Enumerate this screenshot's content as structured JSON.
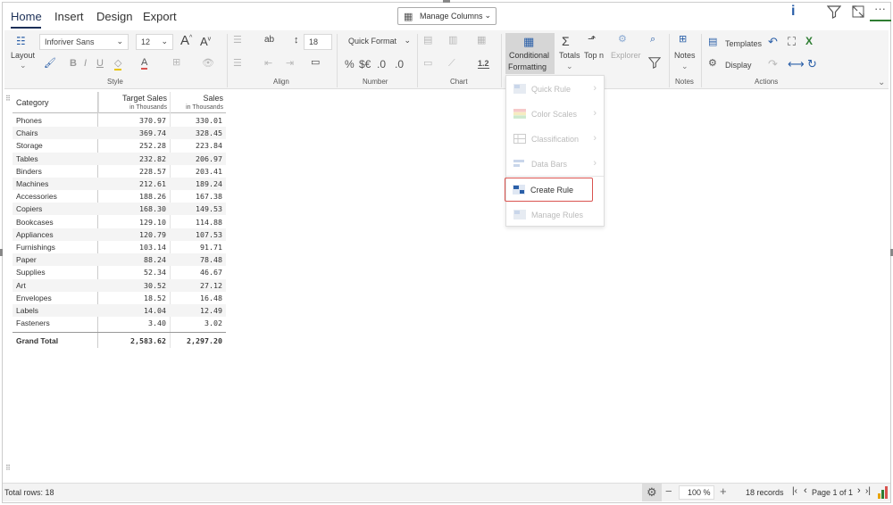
{
  "tabs": [
    "Home",
    "Insert",
    "Design",
    "Export"
  ],
  "manage_columns": "Manage Columns",
  "font_name": "Inforiver Sans",
  "font_size": "12",
  "row_height": "18",
  "number_format": "Quick Format",
  "labels": {
    "layout": "Layout",
    "style": "Style",
    "align": "Align",
    "number": "Number",
    "chart": "Chart",
    "cond1": "Conditional",
    "cond2": "Formatting",
    "totals": "Totals",
    "topn": "Top n",
    "explorer": "Explorer",
    "notes": "Notes",
    "notes_group": "Notes",
    "templates": "Templates",
    "display": "Display",
    "actions": "Actions",
    "percent": "%",
    "currency": "$€",
    "dec_up": ".0",
    "dec_down": ".0",
    "chart_num": "1.2"
  },
  "menu": [
    {
      "label": "Quick Rule",
      "has_sub": true,
      "enabled": false
    },
    {
      "label": "Color Scales",
      "has_sub": true,
      "enabled": false
    },
    {
      "label": "Classification",
      "has_sub": true,
      "enabled": false
    },
    {
      "label": "Data Bars",
      "has_sub": true,
      "enabled": false
    },
    {
      "label": "Create Rule",
      "has_sub": false,
      "enabled": true
    },
    {
      "label": "Manage Rules",
      "has_sub": false,
      "enabled": false
    }
  ],
  "table": {
    "col_category": "Category",
    "col_target": "Target Sales",
    "col_target_sub": "in Thousands",
    "col_sales": "Sales",
    "col_sales_sub": "in Thousands",
    "rows": [
      {
        "category": "Phones",
        "target": "370.97",
        "sales": "330.01"
      },
      {
        "category": "Chairs",
        "target": "369.74",
        "sales": "328.45"
      },
      {
        "category": "Storage",
        "target": "252.28",
        "sales": "223.84"
      },
      {
        "category": "Tables",
        "target": "232.82",
        "sales": "206.97"
      },
      {
        "category": "Binders",
        "target": "228.57",
        "sales": "203.41"
      },
      {
        "category": "Machines",
        "target": "212.61",
        "sales": "189.24"
      },
      {
        "category": "Accessories",
        "target": "188.26",
        "sales": "167.38"
      },
      {
        "category": "Copiers",
        "target": "168.30",
        "sales": "149.53"
      },
      {
        "category": "Bookcases",
        "target": "129.10",
        "sales": "114.88"
      },
      {
        "category": "Appliances",
        "target": "120.79",
        "sales": "107.53"
      },
      {
        "category": "Furnishings",
        "target": "103.14",
        "sales": "91.71"
      },
      {
        "category": "Paper",
        "target": "88.24",
        "sales": "78.48"
      },
      {
        "category": "Supplies",
        "target": "52.34",
        "sales": "46.67"
      },
      {
        "category": "Art",
        "target": "30.52",
        "sales": "27.12"
      },
      {
        "category": "Envelopes",
        "target": "18.52",
        "sales": "16.48"
      },
      {
        "category": "Labels",
        "target": "14.04",
        "sales": "12.49"
      },
      {
        "category": "Fasteners",
        "target": "3.40",
        "sales": "3.02"
      }
    ],
    "total": {
      "category": "Grand Total",
      "target": "2,583.62",
      "sales": "2,297.20"
    }
  },
  "status": {
    "total_rows": "Total rows: 18",
    "zoom": "100 %",
    "records": "18 records",
    "page": "Page 1 of 1"
  },
  "colors": {
    "accent": "#1b2f57",
    "highlight": "#d9534f",
    "green": "#2e7d32"
  }
}
